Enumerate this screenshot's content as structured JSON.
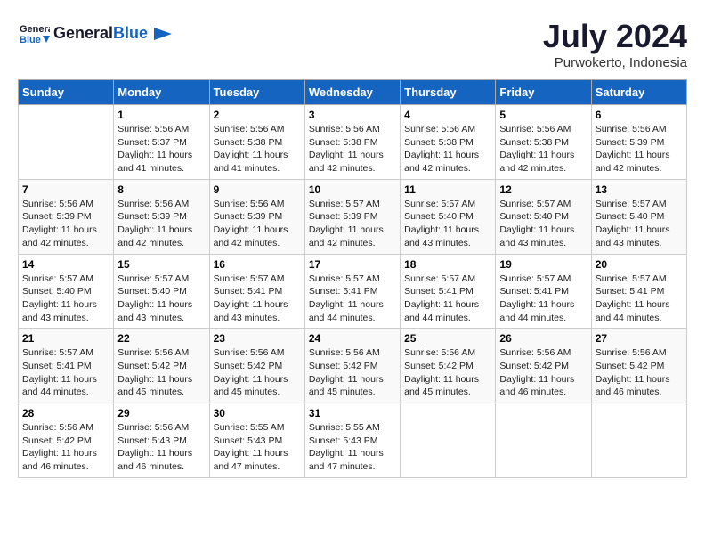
{
  "header": {
    "logo_general": "General",
    "logo_blue": "Blue",
    "month_year": "July 2024",
    "location": "Purwokerto, Indonesia"
  },
  "weekdays": [
    "Sunday",
    "Monday",
    "Tuesday",
    "Wednesday",
    "Thursday",
    "Friday",
    "Saturday"
  ],
  "weeks": [
    [
      {
        "day": "",
        "sunrise": "",
        "sunset": "",
        "daylight": ""
      },
      {
        "day": "1",
        "sunrise": "Sunrise: 5:56 AM",
        "sunset": "Sunset: 5:37 PM",
        "daylight": "Daylight: 11 hours and 41 minutes."
      },
      {
        "day": "2",
        "sunrise": "Sunrise: 5:56 AM",
        "sunset": "Sunset: 5:38 PM",
        "daylight": "Daylight: 11 hours and 41 minutes."
      },
      {
        "day": "3",
        "sunrise": "Sunrise: 5:56 AM",
        "sunset": "Sunset: 5:38 PM",
        "daylight": "Daylight: 11 hours and 42 minutes."
      },
      {
        "day": "4",
        "sunrise": "Sunrise: 5:56 AM",
        "sunset": "Sunset: 5:38 PM",
        "daylight": "Daylight: 11 hours and 42 minutes."
      },
      {
        "day": "5",
        "sunrise": "Sunrise: 5:56 AM",
        "sunset": "Sunset: 5:38 PM",
        "daylight": "Daylight: 11 hours and 42 minutes."
      },
      {
        "day": "6",
        "sunrise": "Sunrise: 5:56 AM",
        "sunset": "Sunset: 5:39 PM",
        "daylight": "Daylight: 11 hours and 42 minutes."
      }
    ],
    [
      {
        "day": "7",
        "sunrise": "Sunrise: 5:56 AM",
        "sunset": "Sunset: 5:39 PM",
        "daylight": "Daylight: 11 hours and 42 minutes."
      },
      {
        "day": "8",
        "sunrise": "Sunrise: 5:56 AM",
        "sunset": "Sunset: 5:39 PM",
        "daylight": "Daylight: 11 hours and 42 minutes."
      },
      {
        "day": "9",
        "sunrise": "Sunrise: 5:56 AM",
        "sunset": "Sunset: 5:39 PM",
        "daylight": "Daylight: 11 hours and 42 minutes."
      },
      {
        "day": "10",
        "sunrise": "Sunrise: 5:57 AM",
        "sunset": "Sunset: 5:39 PM",
        "daylight": "Daylight: 11 hours and 42 minutes."
      },
      {
        "day": "11",
        "sunrise": "Sunrise: 5:57 AM",
        "sunset": "Sunset: 5:40 PM",
        "daylight": "Daylight: 11 hours and 43 minutes."
      },
      {
        "day": "12",
        "sunrise": "Sunrise: 5:57 AM",
        "sunset": "Sunset: 5:40 PM",
        "daylight": "Daylight: 11 hours and 43 minutes."
      },
      {
        "day": "13",
        "sunrise": "Sunrise: 5:57 AM",
        "sunset": "Sunset: 5:40 PM",
        "daylight": "Daylight: 11 hours and 43 minutes."
      }
    ],
    [
      {
        "day": "14",
        "sunrise": "Sunrise: 5:57 AM",
        "sunset": "Sunset: 5:40 PM",
        "daylight": "Daylight: 11 hours and 43 minutes."
      },
      {
        "day": "15",
        "sunrise": "Sunrise: 5:57 AM",
        "sunset": "Sunset: 5:40 PM",
        "daylight": "Daylight: 11 hours and 43 minutes."
      },
      {
        "day": "16",
        "sunrise": "Sunrise: 5:57 AM",
        "sunset": "Sunset: 5:41 PM",
        "daylight": "Daylight: 11 hours and 43 minutes."
      },
      {
        "day": "17",
        "sunrise": "Sunrise: 5:57 AM",
        "sunset": "Sunset: 5:41 PM",
        "daylight": "Daylight: 11 hours and 44 minutes."
      },
      {
        "day": "18",
        "sunrise": "Sunrise: 5:57 AM",
        "sunset": "Sunset: 5:41 PM",
        "daylight": "Daylight: 11 hours and 44 minutes."
      },
      {
        "day": "19",
        "sunrise": "Sunrise: 5:57 AM",
        "sunset": "Sunset: 5:41 PM",
        "daylight": "Daylight: 11 hours and 44 minutes."
      },
      {
        "day": "20",
        "sunrise": "Sunrise: 5:57 AM",
        "sunset": "Sunset: 5:41 PM",
        "daylight": "Daylight: 11 hours and 44 minutes."
      }
    ],
    [
      {
        "day": "21",
        "sunrise": "Sunrise: 5:57 AM",
        "sunset": "Sunset: 5:41 PM",
        "daylight": "Daylight: 11 hours and 44 minutes."
      },
      {
        "day": "22",
        "sunrise": "Sunrise: 5:56 AM",
        "sunset": "Sunset: 5:42 PM",
        "daylight": "Daylight: 11 hours and 45 minutes."
      },
      {
        "day": "23",
        "sunrise": "Sunrise: 5:56 AM",
        "sunset": "Sunset: 5:42 PM",
        "daylight": "Daylight: 11 hours and 45 minutes."
      },
      {
        "day": "24",
        "sunrise": "Sunrise: 5:56 AM",
        "sunset": "Sunset: 5:42 PM",
        "daylight": "Daylight: 11 hours and 45 minutes."
      },
      {
        "day": "25",
        "sunrise": "Sunrise: 5:56 AM",
        "sunset": "Sunset: 5:42 PM",
        "daylight": "Daylight: 11 hours and 45 minutes."
      },
      {
        "day": "26",
        "sunrise": "Sunrise: 5:56 AM",
        "sunset": "Sunset: 5:42 PM",
        "daylight": "Daylight: 11 hours and 46 minutes."
      },
      {
        "day": "27",
        "sunrise": "Sunrise: 5:56 AM",
        "sunset": "Sunset: 5:42 PM",
        "daylight": "Daylight: 11 hours and 46 minutes."
      }
    ],
    [
      {
        "day": "28",
        "sunrise": "Sunrise: 5:56 AM",
        "sunset": "Sunset: 5:42 PM",
        "daylight": "Daylight: 11 hours and 46 minutes."
      },
      {
        "day": "29",
        "sunrise": "Sunrise: 5:56 AM",
        "sunset": "Sunset: 5:43 PM",
        "daylight": "Daylight: 11 hours and 46 minutes."
      },
      {
        "day": "30",
        "sunrise": "Sunrise: 5:55 AM",
        "sunset": "Sunset: 5:43 PM",
        "daylight": "Daylight: 11 hours and 47 minutes."
      },
      {
        "day": "31",
        "sunrise": "Sunrise: 5:55 AM",
        "sunset": "Sunset: 5:43 PM",
        "daylight": "Daylight: 11 hours and 47 minutes."
      },
      {
        "day": "",
        "sunrise": "",
        "sunset": "",
        "daylight": ""
      },
      {
        "day": "",
        "sunrise": "",
        "sunset": "",
        "daylight": ""
      },
      {
        "day": "",
        "sunrise": "",
        "sunset": "",
        "daylight": ""
      }
    ]
  ]
}
